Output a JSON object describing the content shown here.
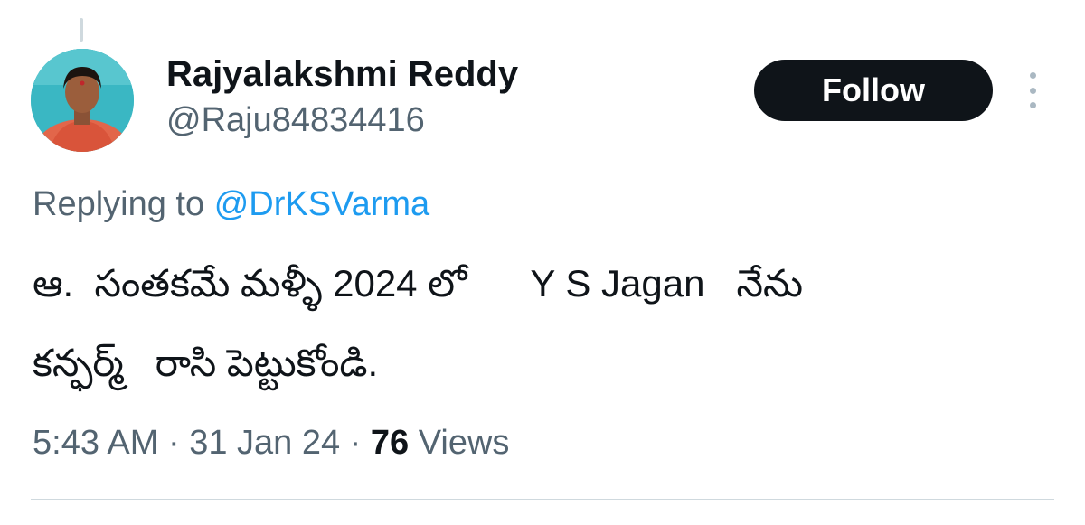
{
  "author": {
    "display_name": "Rajyalakshmi Reddy",
    "handle": "@Raju84834416",
    "avatar_icon": "person-photo-icon"
  },
  "actions": {
    "follow_label": "Follow",
    "more_icon": "more-vertical-icon"
  },
  "reply": {
    "prefix": "Replying to",
    "mention": "@DrKSVarma"
  },
  "tweet": {
    "line1": "ఆ.  సంతకమే మళ్ళీ 2024 లో      Y S Jagan   నేను",
    "line2": "కన్ఫర్మ్   రాసి పెట్టుకోండి."
  },
  "meta": {
    "time": "5:43 AM",
    "separator": " · ",
    "date": "31 Jan 24",
    "views_count": "76",
    "views_label": "Views"
  },
  "colors": {
    "text_primary": "#0f1419",
    "text_secondary": "#536471",
    "link": "#1d9bf0",
    "follow_bg": "#0f1419",
    "divider": "#cfd9de"
  }
}
